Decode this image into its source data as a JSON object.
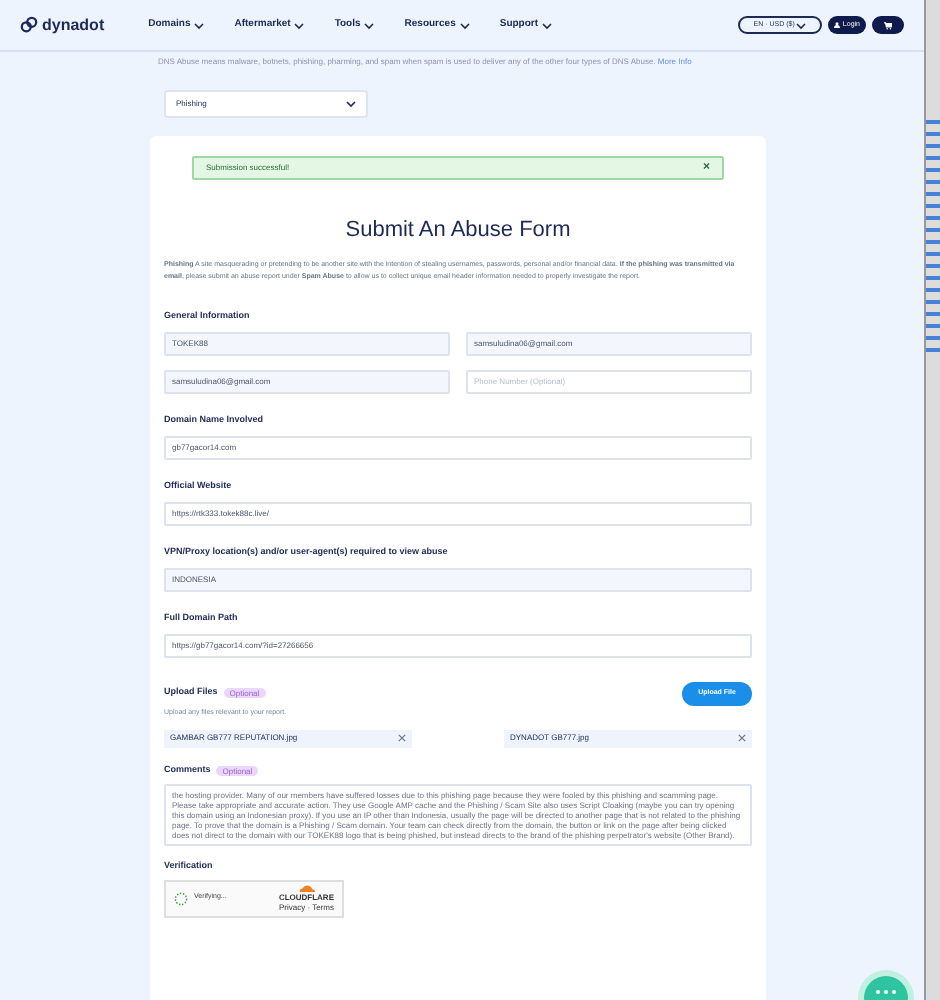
{
  "header": {
    "logo": "dynadot",
    "nav": [
      {
        "label": "Domains"
      },
      {
        "label": "Aftermarket"
      },
      {
        "label": "Tools"
      },
      {
        "label": "Resources"
      },
      {
        "label": "Support"
      }
    ],
    "language": "EN · USD ($)",
    "login": "Login"
  },
  "notice": {
    "text": "DNS Abuse means malware, botnets, phishing, pharming, and spam when spam is used to deliver any of the other four types of DNS Abuse.",
    "link": "More Info"
  },
  "abuse_type": {
    "value": "Phishing"
  },
  "alert": {
    "text": "Submission successful!",
    "close": "×"
  },
  "form": {
    "title": "Submit An Abuse Form",
    "intro": "**Phishing** A site masquerading or pretending to be another site with the intention of stealing usernames, passwords, personal and/or financial data. **If the phishing was transmitted via email**, please submit an abuse report under **Spam Abuse** to allow us to collect unique email header information needed to properly investigate the report.",
    "general_heading": "General Information",
    "general_fields": [
      {
        "value": "TOKEK88",
        "disabled": true
      },
      {
        "value": "samsuludina06@gmail.com",
        "disabled": true
      },
      {
        "value": "samsuludina06@gmail.com",
        "disabled": true
      },
      {
        "placeholder": "Phone Number (Optional)",
        "disabled": false
      }
    ],
    "sections": [
      {
        "label": "Domain Name Involved",
        "value": "gb77gacor14.com",
        "disabled": false
      },
      {
        "label": "Official Website",
        "value": "https://rtk333.tokek88c.live/",
        "disabled": false
      },
      {
        "label": "VPN/Proxy location(s) and/or user-agent(s) required to view abuse",
        "value": "INDONESIA",
        "disabled": true
      },
      {
        "label": "Full Domain Path",
        "value": "https://gb77gacor14.com/?id=27266656",
        "disabled": false
      }
    ],
    "upload": {
      "label": "Upload Files",
      "badge": "Optional",
      "hint": "Upload any files relevant to your report.",
      "button": "Upload File",
      "files": [
        {
          "name": "GAMBAR GB777 REPUTATION.jpg"
        },
        {
          "name": "DYNADOT GB777.jpg"
        }
      ]
    },
    "comments": {
      "label": "Comments",
      "badge": "Optional",
      "value": "the hosting provider. Many of our members have suffered losses due to this phishing page because they were fooled by this phishing and scamming page. Please take appropriate and accurate action. They use Google AMP cache and the Phishing / Scam Site also uses Script Cloaking (maybe you can try opening this domain using an Indonesian proxy). If you use an IP other than Indonesia, usually the page will be directed to another page that is not related to the phishing page. To prove that the domain is a Phishing / Scam domain. Your team can check directly from the domain, the button or link on the page after being clicked does not direct to the domain with our TOKEK88 logo that is being phished, but instead directs to the brand of the phishing perpetrator's website (Other Brand)."
    },
    "verification": {
      "label": "Verification",
      "status": "Verifying...",
      "brand": "CLOUDFLARE",
      "links": "Privacy · Terms"
    }
  }
}
